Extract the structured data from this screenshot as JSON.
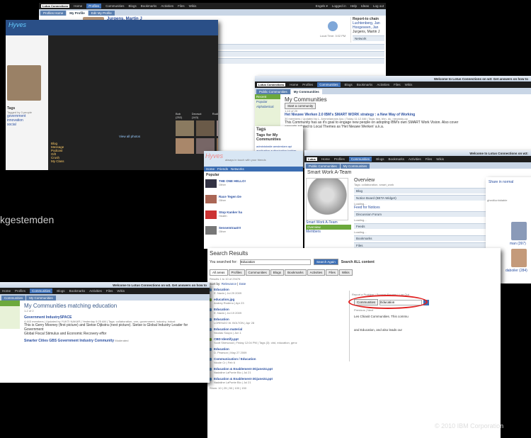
{
  "footer": {
    "copyright": "© 2010 IBM Corporation"
  },
  "partial_word": "kgestemden",
  "profiles": {
    "top_links": [
      "Home",
      "Profiles",
      "Communities",
      "Blogs",
      "Bookmarks",
      "Activities",
      "Files",
      "Wikis"
    ],
    "right_links": [
      "Engels ▾",
      "Logged in",
      "Help",
      "Ideas",
      "Log out"
    ],
    "tabs": [
      "Profiles Home",
      "My Profile",
      "Edit My Profile"
    ],
    "name": "Jurgens, Martin J",
    "info": [
      "IBM employee, Regular",
      "IBM Netherlands",
      "IBM Sales & Distribution, Public Sector",
      "Programmanager BeNeLux Government Affairs & Social Innovation",
      "1 - AMSTERDAM, NETHERLANDS"
    ],
    "local_time": "Local Time: 3:02 PM",
    "report_chain": "Report-to chain",
    "chain": [
      "Luchtenberg, Jan",
      "Hoogeveen, Jan",
      "Jurgens, Martin J"
    ],
    "network": "Network",
    "sections": [
      "Contact information",
      "Background",
      "The Board"
    ],
    "recent_posts": "Recent Posts",
    "post_tabs": [
      "All",
      "Communities",
      "Blogs",
      "Activities",
      "Files",
      "Wiki"
    ],
    "post_title": "Het Nieuwe Werken 2.0 IBM's SMART WORK strategy : a New Way of Working",
    "tags_label": "Tags",
    "tagged_by": "Tagged by 3 people",
    "tag_rows": [
      "government",
      "innovation",
      "social"
    ],
    "side_nav": [
      "Blog",
      "Message",
      "Podcast",
      "Gift",
      "Crush",
      "My Class"
    ],
    "photo_names": [
      "Bob (252)",
      "Decrsot (143)",
      "Rudi",
      "Anthony (128)",
      "Peter",
      "Babby"
    ],
    "view_all": "View all photos"
  },
  "communities": {
    "welcome": "Welcome to Lotus Connections on w3: Get answers on how to",
    "links": [
      "Home",
      "Profiles",
      "Communities",
      "Blogs",
      "Bookmarks",
      "Activities",
      "Files",
      "Wikis"
    ],
    "tabs": [
      "Public Communities",
      "My Communities"
    ],
    "side": [
      "Recent",
      "Popular",
      "Alphabetical"
    ],
    "title": "My Communities",
    "button": "Start a community",
    "count": "1-10 of 29",
    "entry_title": "Het Nieuwe Werken 2.0 IBM's SMART WORK strategy : a New Way of Working",
    "entry_meta": "30 members | Updated by L. Ammelanrans Ijou | Today 11:12 AM | Tags: ibw, bhn, du, nieuwsty-op",
    "entry_desc": "This Community has as it's goal to engage new people on adopting IBM's own SMART Work Vision. Also cover",
    "entry_desc2": "aspects related to Local Themes as 'Het Nieuwe Werken' a.k.a.",
    "tags_title": "Tags",
    "tags_for": "Tags for My Communities",
    "tags": [
      "administratie",
      "amsterdam",
      "api",
      "application",
      "authorization",
      "bakker",
      "belgium",
      "benelux",
      "blue",
      "business",
      "cloud",
      "collaboration",
      "communications",
      "community",
      "crm",
      "data",
      "development",
      "education",
      "eg",
      "events",
      "government",
      "green",
      "ibm",
      "innovation",
      "it",
      "mobile",
      "netherlands",
      "news",
      "pss",
      "public"
    ]
  },
  "hyves": {
    "brand": "Hyves",
    "tagline": "always in touch with your friends",
    "nav": [
      "Home",
      "Friends",
      "Networks"
    ],
    "popular": "Popular",
    "items": [
      {
        "title": "THE ONE HELLO!",
        "sub": "Other"
      },
      {
        "title": "Race Tegen De",
        "sub": "Other"
      },
      {
        "title": "Stop Kanker ha",
        "sub": "Health"
      },
      {
        "title": "Sensemtraat!!!",
        "sub": "Other"
      }
    ]
  },
  "smartwork": {
    "welcome": "Welcome to Lotus Connections on w3:",
    "links": [
      "Home",
      "Profiles",
      "Communities",
      "Blogs",
      "Bookmarks",
      "Activities",
      "Files",
      "Wikis"
    ],
    "tabs": [
      "Public Communities",
      "My Communities"
    ],
    "title": "Smart Work A-Team",
    "overview": "Overview",
    "tags_line": "Tags: collaboration, smart_work",
    "sections": [
      "Blog",
      "Notice Board (BETA Widget)",
      "Discussion Forum",
      "Feeds",
      "Bookmarks",
      "Files",
      "Activities"
    ],
    "loading": "Loading...",
    "feed_label": "Feed for Notices",
    "left_nav": [
      "Smart Work A-Team",
      "Overview",
      "Members"
    ],
    "share": "Share in normal"
  },
  "search": {
    "title": "Search Results",
    "searched_for": "You searched for:",
    "query": "Education",
    "button": "Search Again",
    "all_content": "Search ALL content",
    "tabs": [
      "All areas",
      "Profiles",
      "Communities",
      "Blogs",
      "Bookmarks",
      "Activities",
      "Files",
      "Wikis"
    ],
    "count": "Results 1 to 10 of 29476",
    "sort": "Sort by:",
    "sort_opts": [
      "Relevance",
      "Date"
    ],
    "results": [
      {
        "title": "Education",
        "meta": "E. Navin | Jul 29 2009"
      },
      {
        "title": "education.jpg",
        "meta": "Andrey Rodeno | Apr 23"
      },
      {
        "title": "Education",
        "meta": "E. Navin | Jul 19 2009"
      },
      {
        "title": "Education",
        "meta": "LORENZO W. BOLTON | Apr 28"
      },
      {
        "title": "Education material",
        "meta": "Nicolas Soupo | Jun 1"
      },
      {
        "title": "CBD Identify.ppt",
        "meta": "Scott Sherwood | Friday 12:04 PM | Tags (3): cbd, education, genz"
      },
      {
        "title": "Education",
        "meta": "D. Pearson | May 27 2009"
      },
      {
        "title": "Communication / Education",
        "meta": "Nicole Cr | Feb 6"
      },
      {
        "title": "Education & Enablement-3Gjune24.ppt",
        "meta": "Nadaline LaPonte Bio | Jul 21"
      },
      {
        "title": "Education & Enablement-3Gjune24.ppt",
        "meta": "Nadaline LaPonte Bio | Jul 21"
      }
    ],
    "pager": "Show: 10 | 25 | 50 | 100 | 150",
    "report": "Report a Problem | Support Forums | Log Out",
    "search_box_value": "Education",
    "scope": "Communities",
    "prev_next": "Previous | Next",
    "note": "Les Chiasit Communities. This commu",
    "note2": "and Education, and also leads our"
  },
  "mycomm": {
    "welcome": "Welcome to Lotus Connections on w3. Get answers on how to",
    "links": [
      "Home",
      "Profiles",
      "Communities",
      "Blogs",
      "Bookmarks",
      "Activities",
      "Files",
      "Wikis"
    ],
    "tabs": [
      "Communities",
      "My Communities"
    ],
    "title": "My Communities matching education",
    "count": "1-2 of 2",
    "e1_title": "Government IndustrySPACE",
    "e1_meta": "4,443 members | Updated by YUKTI NAKAR | Yesterday 9:25 AM | Tags: collaboration, crm, government, industry, indust",
    "e1_desc": "This is Gerry Mooney (first picture) and Sietse Dijkstra (next picture). Sietse is Global Industry Leader for Government",
    "e1_desc2": "Global Fiscal Stimulus and Economic Recovery effor",
    "e2_title": "Smarter Cities GBS Government Industry Community",
    "e2_badge": "Moderated"
  },
  "people_right": {
    "share": "Share in normal",
    "sub": "ghedt/unhidable",
    "names": [
      "man (397)",
      "daboiler (284)"
    ]
  }
}
